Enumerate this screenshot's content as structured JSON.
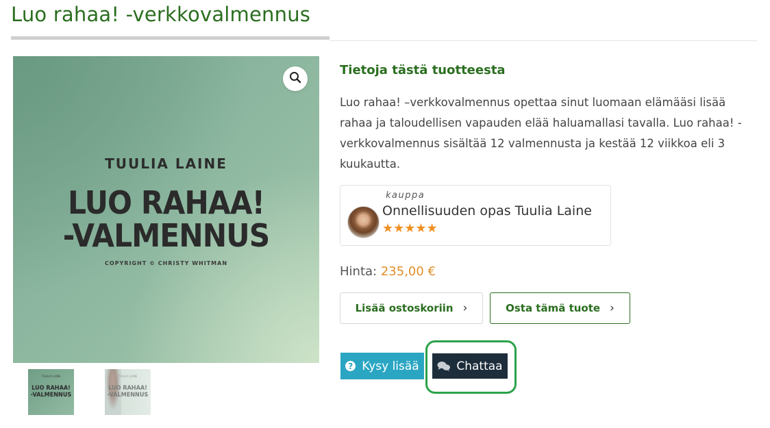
{
  "page": {
    "title": "Luo rahaa! -verkkovalmennus"
  },
  "gallery": {
    "main": {
      "author": "TUULIA LAINE",
      "title_line1": "LUO RAHAA!",
      "title_line2": "-VALMENNUS",
      "copyright": "COPYRIGHT © CHRISTY WHITMAN"
    },
    "zoom_icon": "search-icon",
    "thumbnails": [
      {
        "small": "TUULIA LAINE",
        "line1": "LUO RAHAA!",
        "line2": "-VALMENNUS"
      },
      {
        "small": "TUULIA LAINE",
        "line1": "LUO RAHAA!",
        "line2": "-VALMENNUS"
      }
    ]
  },
  "product": {
    "heading": "Tietoja tästä tuotteesta",
    "description": "Luo rahaa! –verkkovalmennus opettaa sinut luomaan elämääsi lisää rahaa ja taloudellisen vapauden elää haluamallasi tavalla. Luo rahaa! -verkkovalmennus sisältää 12 valmennusta ja kestää 12 viikkoa eli 3 kuukautta."
  },
  "store": {
    "label": "kauppa",
    "name": "Onnellisuuden opas Tuulia Laine",
    "stars": "★★★★★",
    "rating": 5
  },
  "price": {
    "label": "Hinta:",
    "value": "235,00 €"
  },
  "actions": {
    "add_to_cart": "Lisää ostoskoriin",
    "buy_now": "Osta tämä tuote",
    "ask_more": "Kysy lisää",
    "chat": "Chattaa"
  },
  "colors": {
    "brand_green": "#2a6e1f",
    "price_orange": "#e18f2a",
    "ask_blue": "#2aa6c3",
    "chat_dark": "#1e2d3b",
    "highlight_green": "#2aa24a",
    "star_orange": "#f08f22"
  }
}
